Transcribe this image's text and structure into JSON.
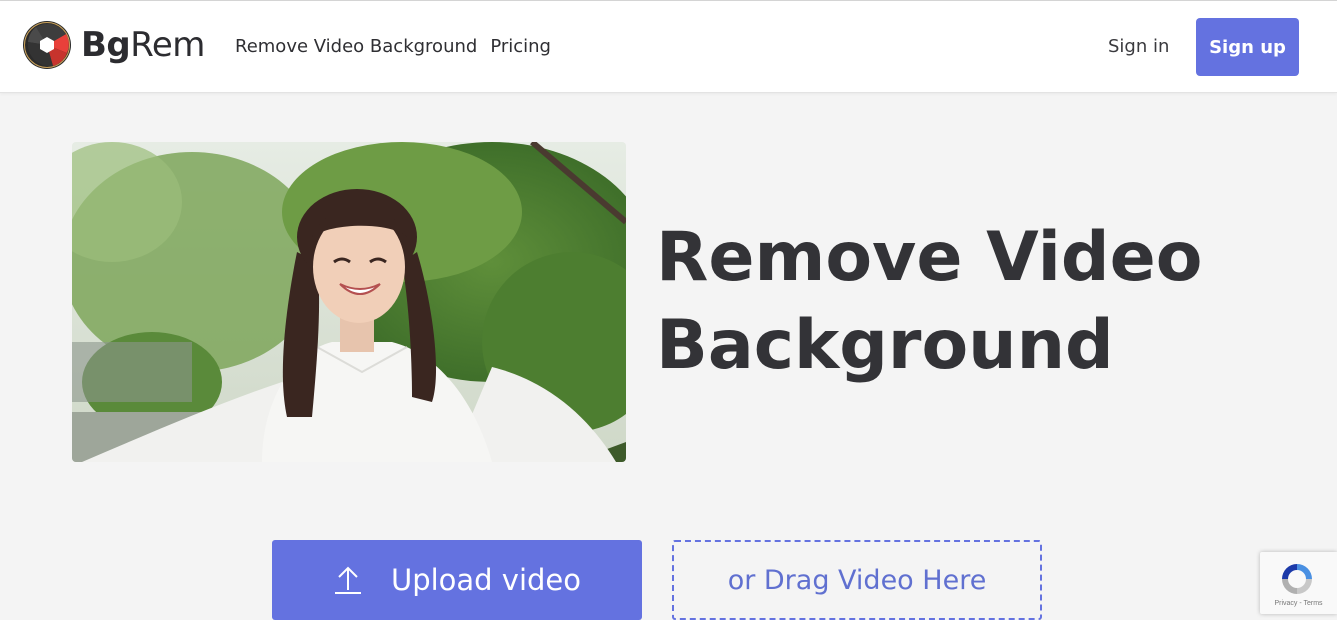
{
  "brand": {
    "name_bold": "Bg",
    "name_light": "Rem"
  },
  "nav": {
    "items": [
      {
        "label": "Remove Video Background"
      },
      {
        "label": "Pricing"
      }
    ]
  },
  "auth": {
    "sign_in_label": "Sign in",
    "sign_up_label": "Sign up"
  },
  "hero": {
    "title_line1": "Remove Video",
    "title_line2": "Background",
    "image_alt": "Smiling woman with outstretched arms in front of trees"
  },
  "upload": {
    "button_label": "Upload video",
    "drop_label": "or Drag Video Here"
  },
  "recaptcha": {
    "footer": "Privacy - Terms"
  },
  "colors": {
    "accent": "#6472e0",
    "text": "#2f2f33",
    "page_bg": "#f4f4f4",
    "logo_red": "#e8403a"
  },
  "icons": [
    "bgrem-logo-icon",
    "upload-arrow-icon",
    "recaptcha-icon"
  ]
}
